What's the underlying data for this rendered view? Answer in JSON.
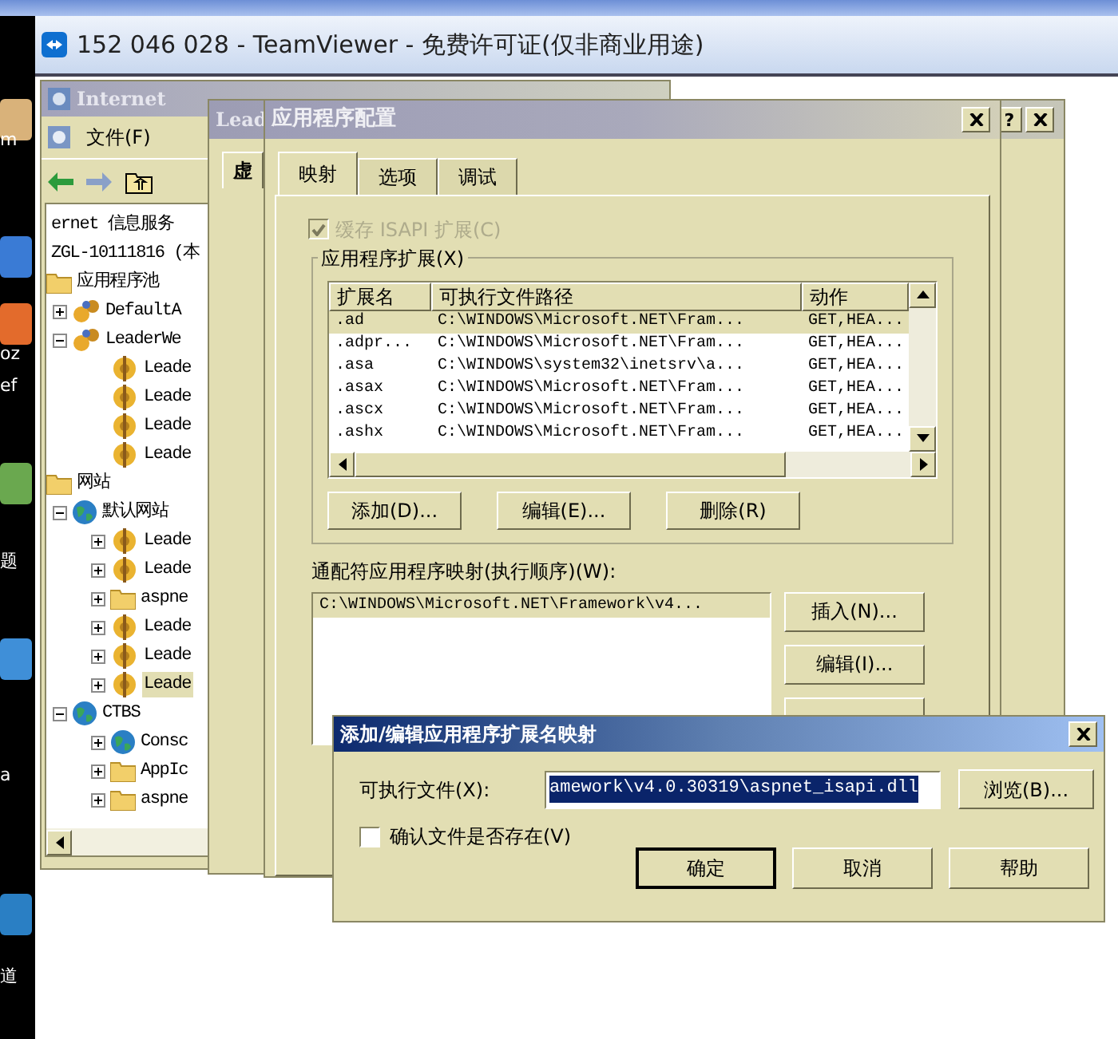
{
  "desktop": {
    "fragments": [
      "m",
      "oz",
      "ef",
      "题",
      "a",
      "道"
    ]
  },
  "teamviewer": {
    "title": "152 046 028 - TeamViewer - 免费许可证(仅非商业用途)"
  },
  "iis_manager": {
    "title": "Internet",
    "menu": [
      "文件(F)"
    ],
    "tree": [
      {
        "label": "ernet 信息服务",
        "selected": false,
        "children": [
          {
            "label": "ZGL-10111816 (本",
            "selected": false,
            "children": [
              {
                "label": "应用程序池",
                "kind": "folder",
                "selected": false,
                "children": [
                  {
                    "label": "DefaultA",
                    "kind": "pool",
                    "expanded": false,
                    "selected": false
                  },
                  {
                    "label": "LeaderWe",
                    "kind": "pool",
                    "expanded": true,
                    "selected": false,
                    "children": [
                      {
                        "label": "Leade",
                        "kind": "app",
                        "selected": false
                      },
                      {
                        "label": "Leade",
                        "kind": "app",
                        "selected": false
                      },
                      {
                        "label": "Leade",
                        "kind": "app",
                        "selected": false
                      },
                      {
                        "label": "Leade",
                        "kind": "app",
                        "selected": false
                      }
                    ]
                  }
                ]
              },
              {
                "label": "网站",
                "kind": "folder",
                "selected": false,
                "children": [
                  {
                    "label": "默认网站",
                    "kind": "globe",
                    "expanded": true,
                    "selected": false,
                    "children": [
                      {
                        "label": "Leade",
                        "kind": "app",
                        "expanded": false,
                        "selected": false
                      },
                      {
                        "label": "Leade",
                        "kind": "app",
                        "expanded": false,
                        "selected": false
                      },
                      {
                        "label": "aspne",
                        "kind": "folder",
                        "expanded": false,
                        "selected": false
                      },
                      {
                        "label": "Leade",
                        "kind": "app",
                        "expanded": false,
                        "selected": false
                      },
                      {
                        "label": "Leade",
                        "kind": "app",
                        "expanded": false,
                        "selected": false
                      },
                      {
                        "label": "Leade",
                        "kind": "app",
                        "expanded": false,
                        "selected": true
                      }
                    ]
                  },
                  {
                    "label": "CTBS",
                    "kind": "globe",
                    "expanded": true,
                    "selected": false,
                    "children": [
                      {
                        "label": "Consc",
                        "kind": "globe",
                        "expanded": false,
                        "selected": false
                      },
                      {
                        "label": "AppIc",
                        "kind": "folder",
                        "expanded": false,
                        "selected": false
                      },
                      {
                        "label": "aspne",
                        "kind": "folder",
                        "expanded": false,
                        "selected": false
                      }
                    ]
                  }
                ]
              }
            ]
          }
        ]
      }
    ]
  },
  "properties_dialog": {
    "title": "Lead",
    "help_button": "?",
    "tabs": [
      {
        "label": "虚",
        "selected": true
      }
    ]
  },
  "config_dialog": {
    "title": "应用程序配置",
    "tabs": [
      {
        "label": "映射",
        "selected": true
      },
      {
        "label": "选项",
        "selected": false
      },
      {
        "label": "调试",
        "selected": false
      }
    ],
    "cache_checkbox": {
      "label": "缓存 ISAPI 扩展(C)",
      "checked": true,
      "disabled": true
    },
    "extensions": {
      "title": "应用程序扩展(X)",
      "columns": [
        "扩展名",
        "可执行文件路径",
        "动作"
      ],
      "rows": [
        {
          "cells": [
            ".ad",
            "C:\\WINDOWS\\Microsoft.NET\\Fram...",
            "GET,HEA..."
          ],
          "selected": true
        },
        {
          "cells": [
            ".adpr...",
            "C:\\WINDOWS\\Microsoft.NET\\Fram...",
            "GET,HEA..."
          ],
          "selected": false
        },
        {
          "cells": [
            ".asa",
            "C:\\WINDOWS\\system32\\inetsrv\\a...",
            "GET,HEA..."
          ],
          "selected": false
        },
        {
          "cells": [
            ".asax",
            "C:\\WINDOWS\\Microsoft.NET\\Fram...",
            "GET,HEA..."
          ],
          "selected": false
        },
        {
          "cells": [
            ".ascx",
            "C:\\WINDOWS\\Microsoft.NET\\Fram...",
            "GET,HEA..."
          ],
          "selected": false
        },
        {
          "cells": [
            ".ashx",
            "C:\\WINDOWS\\Microsoft.NET\\Fram...",
            "GET,HEA..."
          ],
          "selected": false
        }
      ],
      "buttons": [
        "添加(D)...",
        "编辑(E)...",
        "删除(R)"
      ]
    },
    "wildcard": {
      "label": "通配符应用程序映射(执行顺序)(W):",
      "rows": [
        "C:\\WINDOWS\\Microsoft.NET\\Framework\\v4..."
      ],
      "buttons": [
        "插入(N)...",
        "编辑(I)..."
      ]
    }
  },
  "edit_dialog": {
    "title": "添加/编辑应用程序扩展名映射",
    "field_label": "可执行文件(X):",
    "field_value": "amework\\v4.0.30319\\aspnet_isapi.dll",
    "browse": "浏览(B)...",
    "verify_checkbox": {
      "label": "确认文件是否存在(V)",
      "checked": false
    },
    "buttons": [
      {
        "label": "确定",
        "default": true
      },
      {
        "label": "取消",
        "default": false
      },
      {
        "label": "帮助",
        "default": false
      }
    ]
  }
}
